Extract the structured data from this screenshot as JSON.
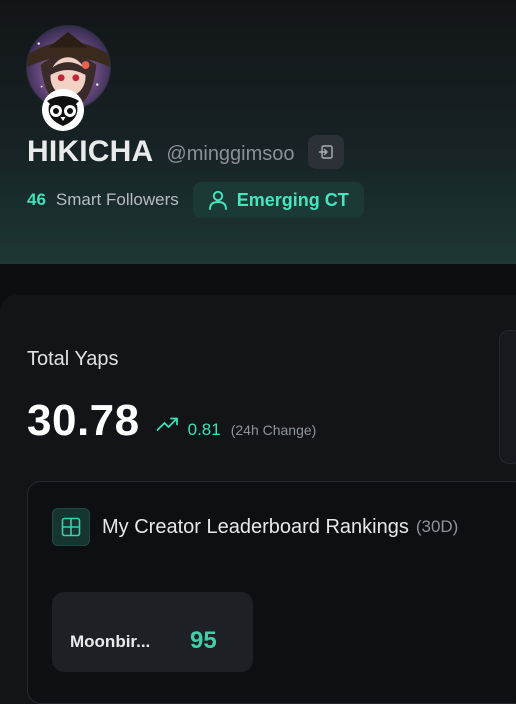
{
  "profile": {
    "display_name": "HIKICHA",
    "handle": "@minggimsoo",
    "smart_followers_count": "46",
    "smart_followers_label": "Smart Followers",
    "tier_label": "Emerging CT"
  },
  "yaps": {
    "title": "Total Yaps",
    "total": "30.78",
    "change": "0.81",
    "change_label": "(24h Change)"
  },
  "rankings": {
    "title": "My Creator Leaderboard Rankings",
    "period": "(30D)",
    "items": [
      {
        "name": "Moonbir...",
        "rank": "95",
        "logo_icon": "owl-logo-icon"
      }
    ]
  },
  "colors": {
    "accent": "#3fe0b6",
    "badge_bg": "#1b3a36",
    "card_bg": "#121417"
  }
}
